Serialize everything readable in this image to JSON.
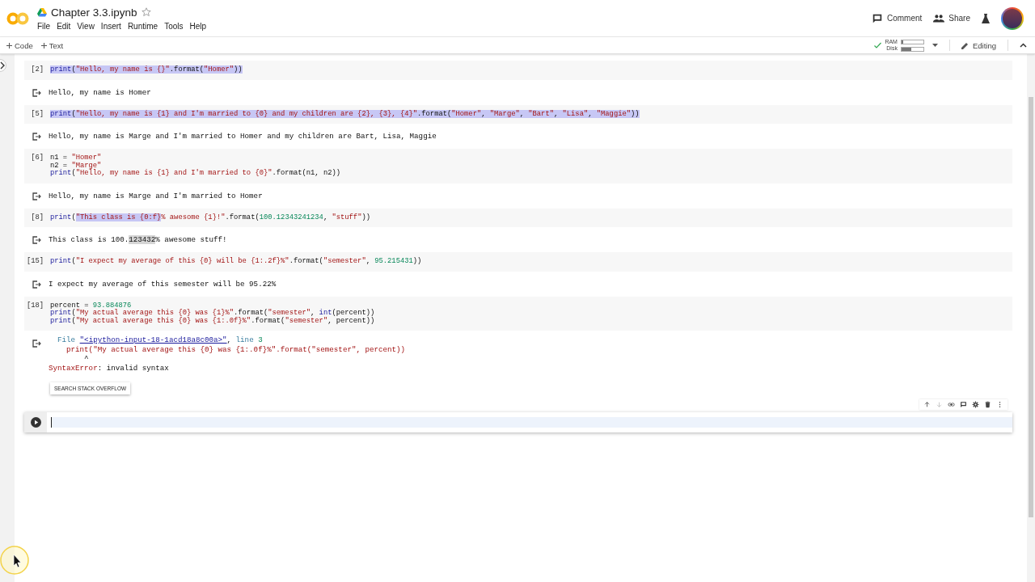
{
  "header": {
    "title": "Chapter 3.3.ipynb",
    "starred": false,
    "menu": [
      "File",
      "Edit",
      "View",
      "Insert",
      "Runtime",
      "Tools",
      "Help"
    ],
    "actions": [
      {
        "kind": "comment",
        "label": "Comment"
      },
      {
        "kind": "share",
        "label": "Share"
      }
    ]
  },
  "toolbar": {
    "insert": [
      {
        "label": "Code"
      },
      {
        "label": "Text"
      }
    ],
    "connected": true,
    "resources": [
      {
        "label": "RAM",
        "level": 0.08
      },
      {
        "label": "Disk",
        "level": 0.45
      }
    ],
    "mode": "Editing"
  },
  "cells": [
    {
      "kind": "code",
      "focused": false,
      "count": "[2]",
      "lines": [
        [
          {
            "text": "print",
            "kind": "fn",
            "highlighted": true
          },
          {
            "text": "(",
            "kind": "plain",
            "highlighted": true
          },
          {
            "text": "\"Hello, my name is {}\"",
            "kind": "str",
            "highlighted": true
          },
          {
            "text": ".format(",
            "kind": "plain",
            "highlighted": true
          },
          {
            "text": "\"Homer\"",
            "kind": "str",
            "highlighted": true
          },
          {
            "text": "))",
            "kind": "plain",
            "highlighted": true
          }
        ]
      ],
      "output": {
        "kind": "stream",
        "lines": [
          [
            {
              "text": "Hello, my name is Homer",
              "kind": "plain",
              "highlighted": false
            }
          ]
        ]
      }
    },
    {
      "kind": "code",
      "focused": false,
      "count": "[5]",
      "lines": [
        [
          {
            "text": "print",
            "kind": "fn",
            "highlighted": true
          },
          {
            "text": "(",
            "kind": "plain",
            "highlighted": true
          },
          {
            "text": "\"Hello, my name is {1} and I'm married to {0} and my children are {2}, {3}, {4}\"",
            "kind": "str",
            "highlighted": true
          },
          {
            "text": ".format(",
            "kind": "plain",
            "highlighted": true
          },
          {
            "text": "\"Homer\"",
            "kind": "str",
            "highlighted": true
          },
          {
            "text": ", ",
            "kind": "plain",
            "highlighted": true
          },
          {
            "text": "\"Marge\"",
            "kind": "str",
            "highlighted": true
          },
          {
            "text": ", ",
            "kind": "plain",
            "highlighted": true
          },
          {
            "text": "\"Bart\"",
            "kind": "str",
            "highlighted": true
          },
          {
            "text": ", ",
            "kind": "plain",
            "highlighted": true
          },
          {
            "text": "\"Lisa\"",
            "kind": "str",
            "highlighted": true
          },
          {
            "text": ", ",
            "kind": "plain",
            "highlighted": true
          },
          {
            "text": "\"Maggie\"",
            "kind": "str",
            "highlighted": true
          },
          {
            "text": "))",
            "kind": "plain",
            "highlighted": true
          }
        ]
      ],
      "output": {
        "kind": "stream",
        "lines": [
          [
            {
              "text": "Hello, my name is Marge and I'm married to Homer and my children are Bart, Lisa, Maggie",
              "kind": "plain",
              "highlighted": false
            }
          ]
        ]
      }
    },
    {
      "kind": "code",
      "focused": false,
      "count": "[6]",
      "lines": [
        [
          {
            "text": "n1 = ",
            "kind": "plain",
            "highlighted": false
          },
          {
            "text": "\"Homer\"",
            "kind": "str",
            "highlighted": false
          }
        ],
        [
          {
            "text": "n2 = ",
            "kind": "plain",
            "highlighted": false
          },
          {
            "text": "\"Marge\"",
            "kind": "str",
            "highlighted": false
          }
        ],
        [
          {
            "text": "print",
            "kind": "fn",
            "highlighted": false
          },
          {
            "text": "(",
            "kind": "plain",
            "highlighted": false
          },
          {
            "text": "\"Hello, my name is {1} and I'm married to {0}\"",
            "kind": "str",
            "highlighted": false
          },
          {
            "text": ".format(n1, n2))",
            "kind": "plain",
            "highlighted": false
          }
        ]
      ],
      "output": {
        "kind": "stream",
        "lines": [
          [
            {
              "text": "Hello, my name is Marge and I'm married to Homer",
              "kind": "plain",
              "highlighted": false
            }
          ]
        ]
      }
    },
    {
      "kind": "code",
      "focused": false,
      "count": "[8]",
      "lines": [
        [
          {
            "text": "print",
            "kind": "fn",
            "highlighted": false
          },
          {
            "text": "(",
            "kind": "plain",
            "highlighted": false
          },
          {
            "text": "\"This class is {0:f}",
            "kind": "str",
            "highlighted": true
          },
          {
            "text": "% awesome {1}!\"",
            "kind": "str",
            "highlighted": false
          },
          {
            "text": ".format(",
            "kind": "plain",
            "highlighted": false
          },
          {
            "text": "100.12343241234",
            "kind": "num",
            "highlighted": false
          },
          {
            "text": ", ",
            "kind": "plain",
            "highlighted": false
          },
          {
            "text": "\"stuff\"",
            "kind": "str",
            "highlighted": false
          },
          {
            "text": "))",
            "kind": "plain",
            "highlighted": false
          }
        ]
      ],
      "output": {
        "kind": "stream",
        "lines": [
          [
            {
              "text": "This class is 100.",
              "kind": "plain",
              "highlighted": false
            },
            {
              "text": "123432",
              "kind": "plain",
              "highlighted": true
            },
            {
              "text": "% awesome stuff!",
              "kind": "plain",
              "highlighted": false
            }
          ]
        ]
      }
    },
    {
      "kind": "code",
      "focused": false,
      "count": "[15]",
      "lines": [
        [
          {
            "text": "print",
            "kind": "fn",
            "highlighted": false
          },
          {
            "text": "(",
            "kind": "plain",
            "highlighted": false
          },
          {
            "text": "\"I expect my average of this {0} will be {1:.2f}%\"",
            "kind": "str",
            "highlighted": false
          },
          {
            "text": ".format(",
            "kind": "plain",
            "highlighted": false
          },
          {
            "text": "\"semester\"",
            "kind": "str",
            "highlighted": false
          },
          {
            "text": ", ",
            "kind": "plain",
            "highlighted": false
          },
          {
            "text": "95.215431",
            "kind": "num",
            "highlighted": false
          },
          {
            "text": "))",
            "kind": "plain",
            "highlighted": false
          }
        ]
      ],
      "output": {
        "kind": "stream",
        "lines": [
          [
            {
              "text": "I expect my average of this semester will be 95.22%",
              "kind": "plain",
              "highlighted": false
            }
          ]
        ]
      }
    },
    {
      "kind": "code",
      "focused": false,
      "count": "[18]",
      "lines": [
        [
          {
            "text": "percent = ",
            "kind": "plain",
            "highlighted": false
          },
          {
            "text": "93.884876",
            "kind": "num",
            "highlighted": false
          }
        ],
        [
          {
            "text": "print",
            "kind": "fn",
            "highlighted": false
          },
          {
            "text": "(",
            "kind": "plain",
            "highlighted": false
          },
          {
            "text": "\"My actual average this {0} was {1}%\"",
            "kind": "str",
            "highlighted": false
          },
          {
            "text": ".format(",
            "kind": "plain",
            "highlighted": false
          },
          {
            "text": "\"semester\"",
            "kind": "str",
            "highlighted": false
          },
          {
            "text": ", ",
            "kind": "plain",
            "highlighted": false
          },
          {
            "text": "int",
            "kind": "fn",
            "highlighted": false
          },
          {
            "text": "(percent))",
            "kind": "plain",
            "highlighted": false
          }
        ],
        [
          {
            "text": "print",
            "kind": "fn",
            "highlighted": false
          },
          {
            "text": "(",
            "kind": "plain",
            "highlighted": false
          },
          {
            "text": "\"My actual average this {0} was {1:.0f}%\"",
            "kind": "str",
            "highlighted": false
          },
          {
            "text": ".format(",
            "kind": "plain",
            "highlighted": false
          },
          {
            "text": "\"semester\"",
            "kind": "str",
            "highlighted": false
          },
          {
            "text": ", percent))",
            "kind": "plain",
            "highlighted": false
          }
        ]
      ],
      "output": {
        "kind": "error",
        "lines": [
          [
            {
              "text": "  File ",
              "kind": "label",
              "highlighted": false
            },
            {
              "text": "\"<ipython-input-18-1acd18a8c00a>\"",
              "kind": "link",
              "highlighted": false
            },
            {
              "text": ", ",
              "kind": "plain",
              "highlighted": false
            },
            {
              "text": "line ",
              "kind": "label",
              "highlighted": false
            },
            {
              "text": "3",
              "kind": "num",
              "highlighted": false
            }
          ],
          [
            {
              "text": "    print(\"My actual average this {0} was {1:.0f}%\".format(\"semester\", percent))",
              "kind": "str",
              "highlighted": false
            }
          ],
          [
            {
              "text": "        ^",
              "kind": "plain",
              "highlighted": false
            }
          ],
          [
            {
              "text": "SyntaxError",
              "kind": "str",
              "highlighted": false
            },
            {
              "text": ": invalid syntax",
              "kind": "plain",
              "highlighted": false
            }
          ]
        ],
        "button": "SEARCH STACK OVERFLOW"
      }
    },
    {
      "kind": "code",
      "focused": true,
      "tools": [
        {
          "kind": "up",
          "disabled": false
        },
        {
          "kind": "down",
          "disabled": true
        },
        {
          "kind": "link",
          "disabled": false
        },
        {
          "kind": "comment",
          "disabled": false
        },
        {
          "kind": "settings",
          "disabled": false
        },
        {
          "kind": "delete",
          "disabled": false
        },
        {
          "kind": "more",
          "disabled": false
        }
      ]
    }
  ]
}
